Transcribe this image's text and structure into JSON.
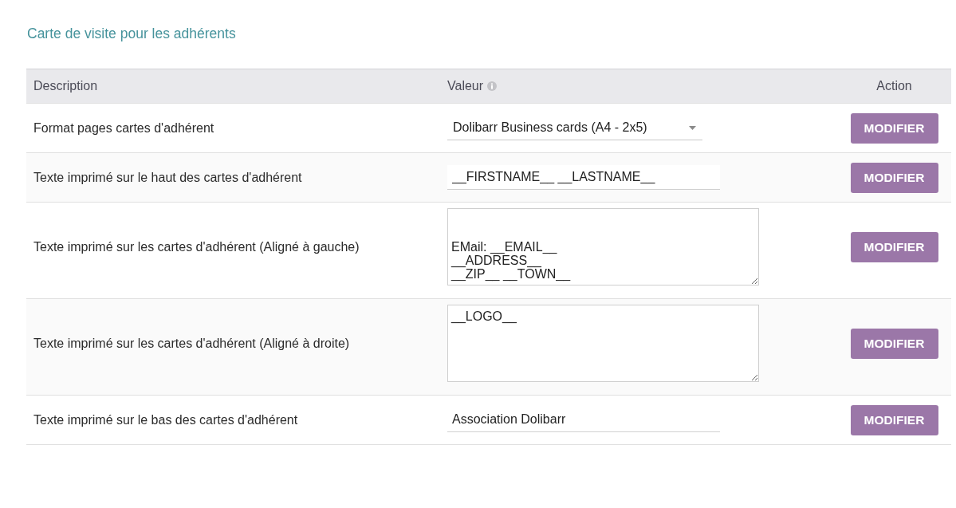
{
  "section_title": "Carte de visite pour les adhérents",
  "table": {
    "columns": [
      {
        "label": "Description"
      },
      {
        "label": "Valeur",
        "info_icon": true
      },
      {
        "label": "Action"
      }
    ],
    "rows": [
      {
        "description": "Format pages cartes d'adhérent",
        "field": {
          "kind": "select",
          "value": "Dolibarr Business cards (A4 - 2x5)"
        },
        "button": "MODIFIER"
      },
      {
        "description": "Texte imprimé sur le haut des cartes d'adhérent",
        "field": {
          "kind": "text",
          "value": "__FIRSTNAME__ __LASTNAME__"
        },
        "button": "MODIFIER"
      },
      {
        "description": "Texte imprimé sur les cartes d'adhérent (Aligné à gauche)",
        "field": {
          "kind": "textarea",
          "value": "\n\nEMail: __EMAIL__\n__ADDRESS__\n__ZIP__ __TOWN__"
        },
        "button": "MODIFIER"
      },
      {
        "description": "Texte imprimé sur les cartes d'adhérent (Aligné à droite)",
        "field": {
          "kind": "textarea",
          "value": "__LOGO__"
        },
        "button": "MODIFIER"
      },
      {
        "description": "Texte imprimé sur le bas des cartes d'adhérent",
        "field": {
          "kind": "text",
          "value": "Association Dolibarr"
        },
        "button": "MODIFIER"
      }
    ]
  }
}
